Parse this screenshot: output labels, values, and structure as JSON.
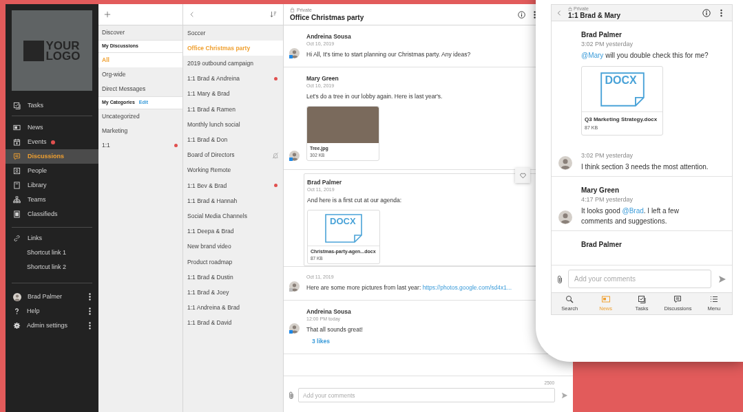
{
  "sidebar": {
    "logo_lines": [
      "YOUR",
      "LOGO"
    ],
    "groups": [
      [
        {
          "label": "Tasks",
          "selected": false,
          "unread": false
        }
      ],
      [
        {
          "label": "News",
          "selected": false,
          "unread": false
        },
        {
          "label": "Events",
          "selected": false,
          "unread": true
        },
        {
          "label": "Discussions",
          "selected": true,
          "unread": false
        },
        {
          "label": "People",
          "selected": false,
          "unread": false
        },
        {
          "label": "Library",
          "selected": false,
          "unread": false
        },
        {
          "label": "Teams",
          "selected": false,
          "unread": false
        },
        {
          "label": "Classifieds",
          "selected": false,
          "unread": false
        }
      ]
    ],
    "links": {
      "label": "Links",
      "items": [
        "Shortcut link 1",
        "Shortcut link 2"
      ]
    },
    "footer": [
      {
        "label": "Brad Palmer"
      },
      {
        "label": "Help"
      },
      {
        "label": "Admin settings"
      }
    ]
  },
  "categories": [
    {
      "kind": "row",
      "label": "Discover",
      "selected": false,
      "unread": false
    },
    {
      "kind": "header",
      "label": "My Discussions"
    },
    {
      "kind": "row",
      "label": "All",
      "selected": true,
      "unread": false
    },
    {
      "kind": "row",
      "label": "Org-wide",
      "selected": false,
      "unread": false
    },
    {
      "kind": "row",
      "label": "Direct Messages",
      "selected": false,
      "unread": false
    },
    {
      "kind": "header",
      "label": "My Categories",
      "action": "Edit"
    },
    {
      "kind": "row",
      "label": "Uncategorized",
      "selected": false,
      "unread": false
    },
    {
      "kind": "row",
      "label": "Marketing",
      "selected": false,
      "unread": false
    },
    {
      "kind": "row",
      "label": "1:1",
      "selected": false,
      "unread": true
    }
  ],
  "discussions": [
    {
      "label": "Soccer",
      "selected": false,
      "unread": false,
      "muted": false
    },
    {
      "label": "Office Christmas party",
      "selected": true,
      "unread": false,
      "muted": false
    },
    {
      "label": "2019 outbound campaign",
      "selected": false,
      "unread": false,
      "muted": false
    },
    {
      "label": "1:1 Brad & Andreina",
      "selected": false,
      "unread": true,
      "muted": false
    },
    {
      "label": "1:1 Mary & Brad",
      "selected": false,
      "unread": false,
      "muted": false
    },
    {
      "label": "1:1 Brad & Ramen",
      "selected": false,
      "unread": false,
      "muted": false
    },
    {
      "label": "Monthly lunch social",
      "selected": false,
      "unread": false,
      "muted": false
    },
    {
      "label": "1:1 Brad & Don",
      "selected": false,
      "unread": false,
      "muted": false
    },
    {
      "label": "Board of Directors",
      "selected": false,
      "unread": false,
      "muted": true
    },
    {
      "label": "Working Remote",
      "selected": false,
      "unread": false,
      "muted": false
    },
    {
      "label": "1:1 Bev & Brad",
      "selected": false,
      "unread": true,
      "muted": false
    },
    {
      "label": "1:1 Brad & Hannah",
      "selected": false,
      "unread": false,
      "muted": false
    },
    {
      "label": "Social Media Channels",
      "selected": false,
      "unread": false,
      "muted": false
    },
    {
      "label": "1:1 Deepa & Brad",
      "selected": false,
      "unread": false,
      "muted": false
    },
    {
      "label": "New brand video",
      "selected": false,
      "unread": false,
      "muted": false
    },
    {
      "label": "Product roadmap",
      "selected": false,
      "unread": false,
      "muted": false
    },
    {
      "label": "1:1 Brad & Dustin",
      "selected": false,
      "unread": false,
      "muted": false
    },
    {
      "label": "1:1 Brad & Joey",
      "selected": false,
      "unread": false,
      "muted": false
    },
    {
      "label": "1:1 Andreina & Brad",
      "selected": false,
      "unread": false,
      "muted": false
    },
    {
      "label": "1:1 Brad & David",
      "selected": false,
      "unread": false,
      "muted": false
    }
  ],
  "chat": {
    "privacy": "Private",
    "title": "Office Christmas party",
    "messages": [
      {
        "author": "Andreina Sousa",
        "time": "Oct 10, 2019",
        "parts": [
          {
            "kind": "text",
            "text": "Hi All, It's time to start planning our Christmas party. Any ideas?"
          }
        ],
        "avatar": true,
        "online": true,
        "highlighted": false
      },
      {
        "author": "Mary Green",
        "time": "Oct 10, 2019",
        "parts": [
          {
            "kind": "text",
            "text": "Let's do a tree in our lobby again. Here is last year's."
          }
        ],
        "attachment": {
          "kind": "image",
          "name": "Tree.jpg",
          "size": "302 KB"
        },
        "avatar": true,
        "online": true,
        "highlighted": false
      },
      {
        "author": "Brad Palmer",
        "time": "Oct 11, 2019",
        "parts": [
          {
            "kind": "text",
            "text": "And here is a first cut at our agenda:"
          }
        ],
        "attachment": {
          "kind": "document",
          "type_label": "DOCX",
          "name": "Christmas-party-agen...docx",
          "size": "87 KB"
        },
        "avatar": false,
        "highlighted": true
      },
      {
        "time": "Oct 11, 2019",
        "parts": [
          {
            "kind": "text",
            "text": "Here are some more pictures from last year: "
          },
          {
            "kind": "link",
            "text": "https://photos.google.com/sd4x1..."
          }
        ],
        "avatar": true,
        "online": false,
        "highlighted": false
      },
      {
        "author": "Andreina Sousa",
        "time": "12:00 PM today",
        "parts": [
          {
            "kind": "text",
            "text": "That all sounds great!"
          }
        ],
        "likes": "3 likes",
        "avatar": true,
        "online": true,
        "highlighted": false
      }
    ],
    "composer": {
      "counter": "2500",
      "placeholder": "Add your comments"
    }
  },
  "phone": {
    "privacy": "Private",
    "title": "1:1 Brad & Mary",
    "messages": [
      {
        "author": "Brad Palmer",
        "time": "3:02 PM yesterday",
        "parts": [
          {
            "kind": "mention",
            "text": "@Mary"
          },
          {
            "kind": "text",
            "text": " will you double check this for me?"
          }
        ],
        "attachment": {
          "kind": "document",
          "type_label": "DOCX",
          "name": "Q3 Marketing Strategy.docx",
          "size": "87 KB"
        },
        "avatar": false
      },
      {
        "time": "3:02 PM yesterday",
        "parts": [
          {
            "kind": "text",
            "text": "I think section 3 needs the most attention."
          }
        ],
        "avatar": true
      },
      {
        "author": "Mary Green",
        "time": "4:17 PM yesterday",
        "parts": [
          {
            "kind": "text",
            "text": "It looks good "
          },
          {
            "kind": "mention",
            "text": "@Brad"
          },
          {
            "kind": "text",
            "text": ". I left a few comments and suggestions."
          }
        ],
        "avatar": true
      },
      {
        "author": "Brad Palmer",
        "avatar": false
      }
    ],
    "composer": {
      "placeholder": "Add your comments"
    },
    "nav": [
      {
        "label": "Search",
        "selected": false
      },
      {
        "label": "News",
        "selected": true
      },
      {
        "label": "Tasks",
        "selected": false
      },
      {
        "label": "Discussions",
        "selected": false
      },
      {
        "label": "Menu",
        "selected": false
      }
    ]
  }
}
